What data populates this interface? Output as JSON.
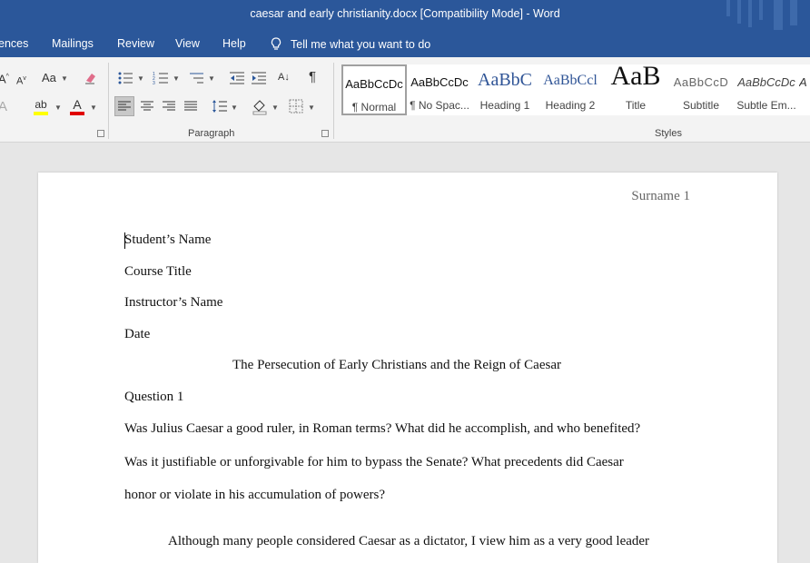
{
  "window": {
    "title": "caesar and early christianity.docx [Compatibility Mode]  -  Word"
  },
  "menu": {
    "references": "ences",
    "mailings": "Mailings",
    "review": "Review",
    "view": "View",
    "help": "Help",
    "tell_me": "Tell me what you want to do"
  },
  "ribbon": {
    "paragraph_label": "Paragraph",
    "styles_label": "Styles",
    "styles": [
      {
        "preview": "AaBbCcDc",
        "name": "¶ Normal"
      },
      {
        "preview": "AaBbCcDc",
        "name": "¶ No Spac..."
      },
      {
        "preview": "AaBbC",
        "name": "Heading 1"
      },
      {
        "preview": "AaBbCcl",
        "name": "Heading 2"
      },
      {
        "preview": "AaB",
        "name": "Title"
      },
      {
        "preview": "AaBbCcD",
        "name": "Subtitle"
      },
      {
        "preview": "AaBbCcDc",
        "name": "Subtle Em..."
      },
      {
        "preview": "A",
        "name": ""
      }
    ],
    "icons": {
      "font_size_up": "A",
      "font_size_down": "A",
      "change_case": "Aa",
      "pilcrow": "¶",
      "sort": "A↓",
      "font_color": "A",
      "text_effects": "A",
      "highlight": "ab"
    },
    "colors": {
      "font_color_bar": "#e00000",
      "highlight_bar": "#ffff00"
    }
  },
  "document": {
    "header": "Surname 1",
    "lines": {
      "student": "Student’s Name",
      "course": "Course Title",
      "instructor": "Instructor’s Name",
      "date": "Date",
      "title": "The Persecution of Early Christians and the Reign of Caesar",
      "question": "Question 1",
      "q_line1": "Was Julius Caesar a good ruler, in Roman terms? What did he accomplish, and who benefited?",
      "q_line2": "Was it justifiable or unforgivable for him to bypass the Senate? What precedents did Caesar",
      "q_line3": "honor or violate in his accumulation of powers?",
      "answer_line1": "Although many people considered Caesar as a dictator, I view him as a very good leader"
    }
  }
}
